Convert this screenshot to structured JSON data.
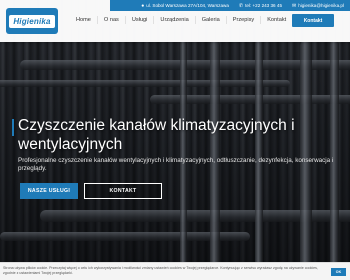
{
  "brand": {
    "logo_text": "Higienika",
    "accent": "#1f7bb8"
  },
  "contact": {
    "address": "ul. Sobol Warszawa 27A/104, Warszawa",
    "phone": "tel: +22 243 36 45",
    "email": "higienika@higienika.pl",
    "icons": [
      "location-icon",
      "phone-icon",
      "mail-icon"
    ]
  },
  "nav": {
    "items": [
      "Home",
      "O nas",
      "Usługi",
      "Urządzenia",
      "Galeria",
      "Przepisy",
      "Kontakt"
    ],
    "cta": "Kontakt"
  },
  "hero": {
    "headline": "Czyszczenie kanałów klimatyzacyjnych i wentylacyjnych",
    "subtitle": "Profesjonalne czyszczenie kanałów wentylacyjnych i klimatyzacyjnych, odtłuszczanie, dezynfekcja, konserwacja i przeglądy.",
    "primary_button": "NASZE USŁUGI",
    "secondary_button": "KONTAKT"
  },
  "cookie": {
    "text": "Strona używa plików cookie. Przeczytaj więcej o celu ich wykorzystywania i możliwości zmiany ustawień cookies w Twojej przeglądarce. Kontynuując z serwisu wyrażasz zgodę na używanie cookies, zgodnie z ustawieniami Twojej przeglądarki.",
    "ok_label": "OK"
  }
}
